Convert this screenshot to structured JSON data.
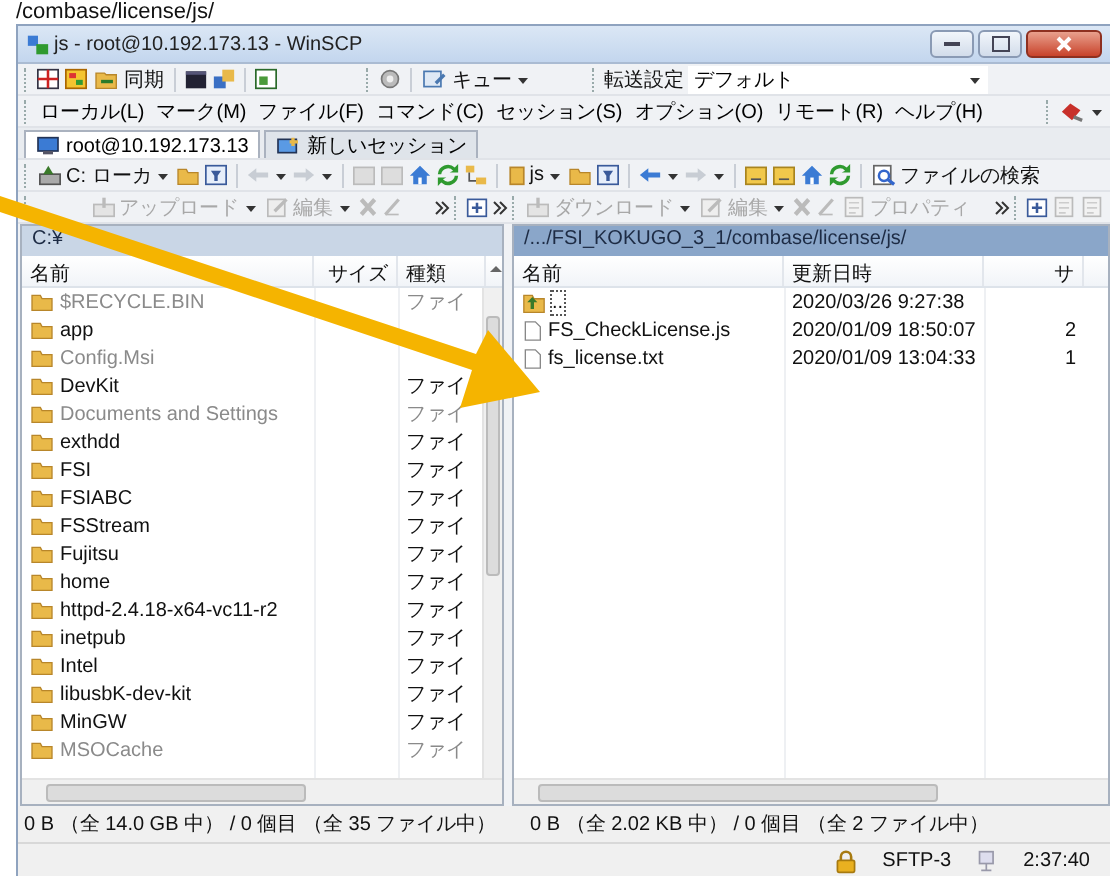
{
  "caption": "/combase/license/js/",
  "annotation_arrow": true,
  "window": {
    "title": "js - root@10.192.173.13 - WinSCP"
  },
  "toolbar": {
    "sync_label": "同期",
    "queue_label": "キュー",
    "transfer_label": "転送設定",
    "transfer_value": "デフォルト"
  },
  "menu": [
    "ローカル(L)",
    "マーク(M)",
    "ファイル(F)",
    "コマンド(C)",
    "セッション(S)",
    "オプション(O)",
    "リモート(R)",
    "ヘルプ(H)"
  ],
  "tabs": [
    {
      "label": "root@10.192.173.13",
      "selected": true
    },
    {
      "label": "新しいセッション",
      "selected": false
    }
  ],
  "local_toolbar": {
    "drive": "C: ローカ"
  },
  "remote_toolbar": {
    "folder": "js",
    "find": "ファイルの検索"
  },
  "local_actions": [
    {
      "label": "アップロード",
      "disabled": true
    },
    {
      "label": "編集",
      "disabled": true
    }
  ],
  "remote_actions": [
    {
      "label": "ダウンロード",
      "disabled": true
    },
    {
      "label": "編集",
      "disabled": true
    },
    {
      "label": "プロパティ",
      "disabled": true
    }
  ],
  "local_panel": {
    "path": "C:¥",
    "columns": [
      "名前",
      "サイズ",
      "種類"
    ],
    "rows": [
      {
        "name": "$RECYCLE.BIN",
        "type": "ファイ",
        "hidden": true
      },
      {
        "name": "app",
        "hidden": false
      },
      {
        "name": "Config.Msi",
        "hidden": true
      },
      {
        "name": "DevKit",
        "type": "ファイ",
        "hidden": false
      },
      {
        "name": "Documents and Settings",
        "type": "ファイ",
        "hidden": true
      },
      {
        "name": "exthdd",
        "type": "ファイ",
        "hidden": false
      },
      {
        "name": "FSI",
        "type": "ファイ",
        "hidden": false
      },
      {
        "name": "FSIABC",
        "type": "ファイ",
        "hidden": false
      },
      {
        "name": "FSStream",
        "type": "ファイ",
        "hidden": false
      },
      {
        "name": "Fujitsu",
        "type": "ファイ",
        "hidden": false
      },
      {
        "name": "home",
        "type": "ファイ",
        "hidden": false
      },
      {
        "name": "httpd-2.4.18-x64-vc11-r2",
        "type": "ファイ",
        "hidden": false
      },
      {
        "name": "inetpub",
        "type": "ファイ",
        "hidden": false
      },
      {
        "name": "Intel",
        "type": "ファイ",
        "hidden": false
      },
      {
        "name": "libusbK-dev-kit",
        "type": "ファイ",
        "hidden": false
      },
      {
        "name": "MinGW",
        "type": "ファイ",
        "hidden": false
      },
      {
        "name": "MSOCache",
        "type": "ファイ",
        "hidden": true
      }
    ]
  },
  "remote_panel": {
    "path": "/.../FSI_KOKUGO_3_1/combase/license/js/",
    "columns": [
      "名前",
      "更新日時",
      "サ"
    ],
    "rows": [
      {
        "kind": "parent",
        "name": "..",
        "modified": "2020/03/26 9:27:38"
      },
      {
        "kind": "file",
        "name": "FS_CheckLicense.js",
        "modified": "2020/01/09 18:50:07",
        "size": "2"
      },
      {
        "kind": "file",
        "name": "fs_license.txt",
        "modified": "2020/01/09 13:04:33",
        "size": "1"
      }
    ]
  },
  "local_status": "0 B （全 14.0 GB 中） / 0 個目 （全 35 ファイル中）",
  "remote_status": "0 B （全 2.02 KB 中） / 0 個目 （全 2 ファイル中）",
  "status_bar": {
    "protocol": "SFTP-3",
    "time": "2:37:40"
  }
}
